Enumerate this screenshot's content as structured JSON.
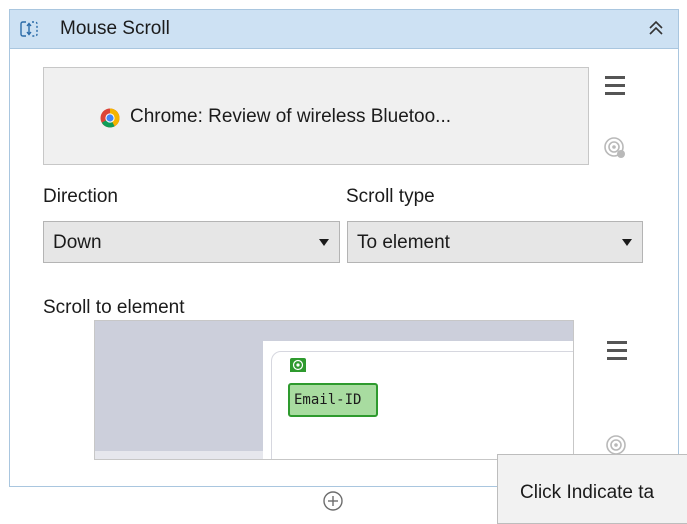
{
  "header": {
    "title": "Mouse Scroll",
    "icon": "mouse-scroll-icon",
    "collapse_icon": "double-chevron-up-icon"
  },
  "target": {
    "browser_icon": "chrome-icon",
    "text": "Chrome: Review of wireless Bluetoo..."
  },
  "direction": {
    "label": "Direction",
    "value": "Down"
  },
  "scroll_type": {
    "label": "Scroll type",
    "value": "To element"
  },
  "scroll_to_element": {
    "label": "Scroll to element",
    "element_text": "Email-ID"
  },
  "tooltip": {
    "text": "Click Indicate ta"
  },
  "colors": {
    "header_bg": "#cde1f3",
    "highlight_green": "#2e9a2e",
    "highlight_fill": "#a8dca0"
  }
}
